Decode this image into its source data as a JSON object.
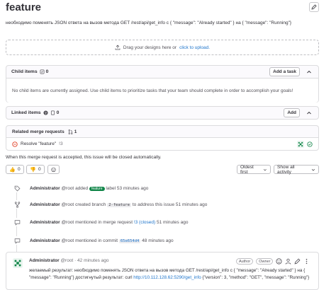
{
  "issue": {
    "title": "feature",
    "description": "необходимо поменять JSON ответа на вызов метода GET /rest/api/get_info с { \"message\": \"Already started\" } на { \"message\": \"Running\"}"
  },
  "design_upload": {
    "text": "Drag your designs here or",
    "link": "click to upload."
  },
  "child_items": {
    "title": "Child items",
    "count": "0",
    "add_button": "Add a task",
    "empty_text": "No child items are currently assigned. Use child items to prioritize tasks that your team should complete in order to accomplish your goals!"
  },
  "linked_items": {
    "title": "Linked items",
    "count": "0",
    "add_button": "Add"
  },
  "merge_requests": {
    "title": "Related merge requests",
    "count": "1",
    "item_title": "Resolve \"feature\"",
    "item_ref": "!3",
    "note": "When this merge request is accepted, this issue will be closed automatically."
  },
  "reactions": {
    "thumbs_up": "0",
    "thumbs_down": "0",
    "sort_label": "Oldest first",
    "filter_label": "Show all activity"
  },
  "timeline": [
    {
      "icon": "label-icon",
      "author": "Administrator",
      "handle": "@root",
      "pre": "added",
      "badge": "feature",
      "post": "label 53 minutes ago"
    },
    {
      "icon": "branch-icon",
      "author": "Administrator",
      "handle": "@root",
      "pre": "created branch",
      "code": "2-feature",
      "post": "to address this issue 51 minutes ago"
    },
    {
      "icon": "comment-icon",
      "author": "Administrator",
      "handle": "@root",
      "pre": "mentioned in merge request",
      "link": "!3 (closed)",
      "post": "51 minutes ago"
    },
    {
      "icon": "comment-icon",
      "author": "Administrator",
      "handle": "@root",
      "pre": "mentioned in commit",
      "link": "65e654d4",
      "post": "48 minutes ago"
    }
  ],
  "comment": {
    "author": "Administrator",
    "handle": "@root",
    "time": "· 42 minutes ago",
    "role_author": "Author",
    "role_owner": "Owner",
    "line1": "желаемый результат: необходимо поменять JSON ответа на вызов метода GET /rest/api/get_info с { \"message\": \"Already started\" } на {",
    "line2_pre": "\"message\": \"Running\"} достигнутый результат: curl",
    "line2_link": "http://10.112.128.62:5290/get_info",
    "line2_post": "{\"version\": 3, \"method\": \"GET\", \"message\": \"Running\"}"
  },
  "colors": {
    "accent": "#1f75cb",
    "success": "#108548",
    "danger": "#dd2b0e",
    "border": "#dcdcde"
  }
}
